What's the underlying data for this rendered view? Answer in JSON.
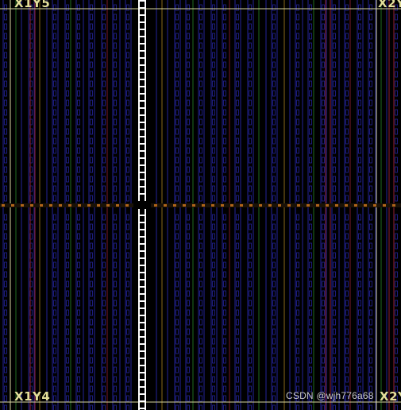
{
  "regions": {
    "top_left": "X1Y5",
    "top_right": "X2Y",
    "bottom_left": "X1Y4",
    "bottom_right": "X2Y"
  },
  "watermark": "CSDN @wjh776a68",
  "colors": {
    "background": "#000000",
    "site_blue": "#23239a",
    "site_green": "#1f6b1f",
    "site_red": "#7a1a2a",
    "site_orange": "#8a6a1a",
    "clock_spine": "#ffffff",
    "region_border": "#d9d6a0",
    "io_marker": "#b0651a",
    "label": "#e3df9a"
  }
}
